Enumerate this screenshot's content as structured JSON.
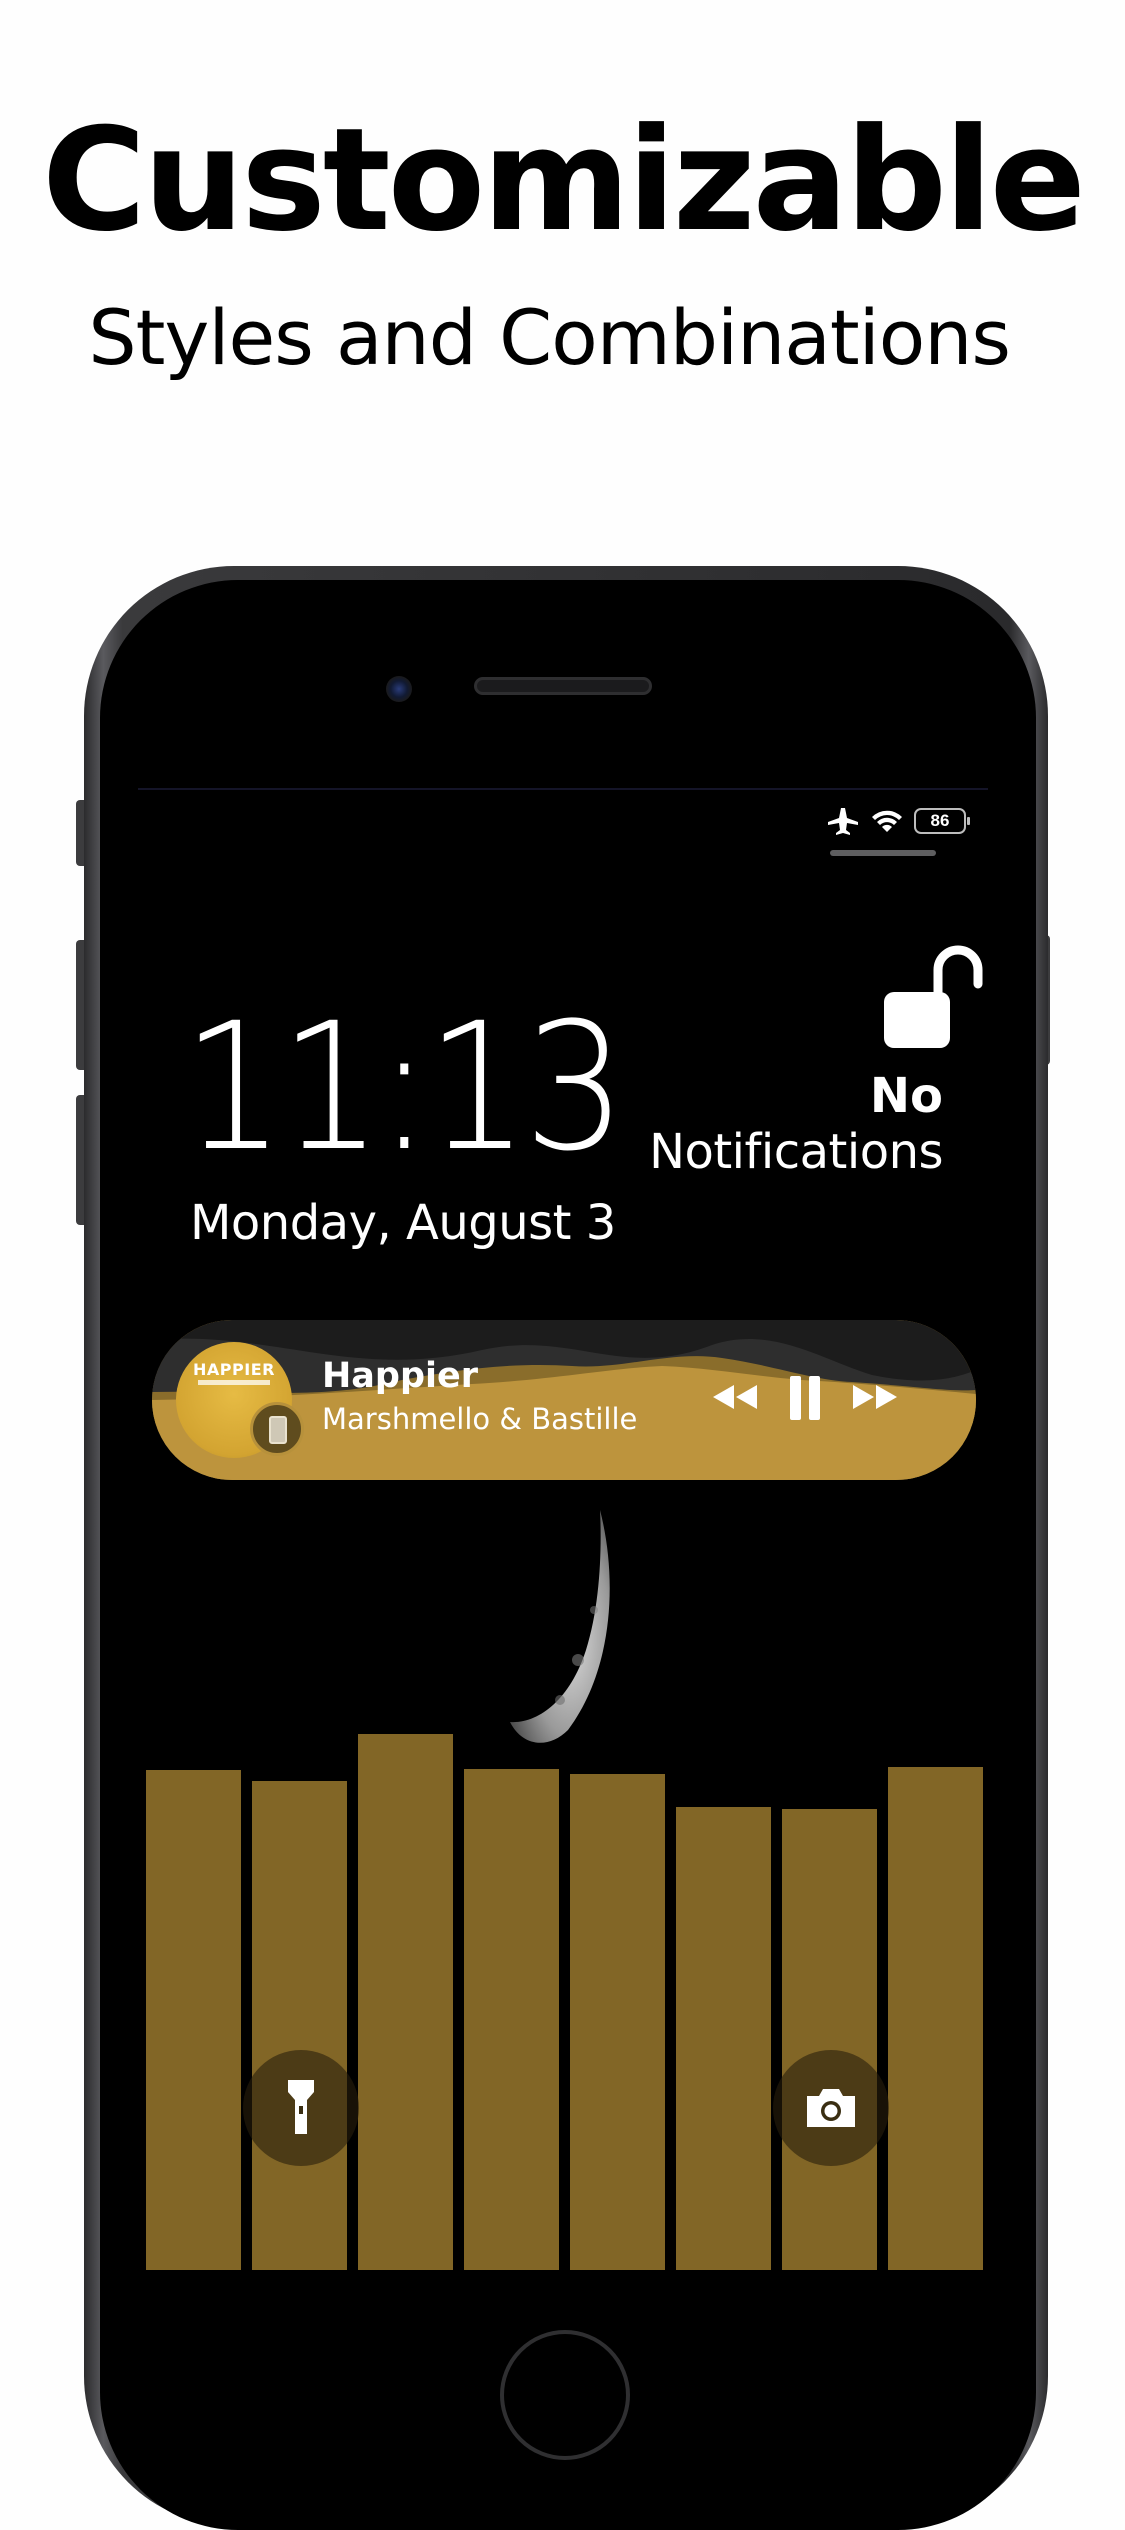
{
  "promo": {
    "title": "Customizable",
    "subtitle": "Styles and Combinations"
  },
  "status_bar": {
    "icons": [
      "airplane-icon",
      "wifi-icon",
      "battery-icon"
    ],
    "battery_level": "86"
  },
  "lockscreen": {
    "time": "11:13",
    "date": "Monday, August 3",
    "notifications_line1": "No",
    "notifications_line2": "Notifications"
  },
  "now_playing": {
    "album_art_text": "HAPPIER",
    "song_title": "Happier",
    "artist": "Marshmello & Bastille",
    "controls": [
      "rewind-icon",
      "pause-icon",
      "fast-forward-icon"
    ]
  },
  "visualizer": {
    "levels": [
      0.892,
      0.874,
      0.957,
      0.894,
      0.885,
      0.826,
      0.823,
      0.898
    ]
  },
  "quick_actions": [
    "flashlight-icon",
    "camera-icon"
  ],
  "colors": {
    "accent_gold": "#bd943d",
    "bar_gold": "#826626",
    "screen_bg": "#000000"
  }
}
